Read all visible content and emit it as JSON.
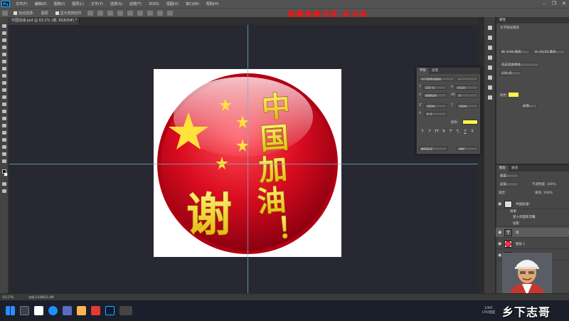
{
  "app": {
    "logo": "Ps",
    "tab_title": "中国加油.psd @ 63.2% (谢, RGB/8#) *"
  },
  "menu": [
    "文件(F)",
    "编辑(E)",
    "图像(I)",
    "图层(L)",
    "文字(Y)",
    "选择(S)",
    "滤镜(T)",
    "3D(D)",
    "视图(V)",
    "窗口(W)",
    "帮助(H)"
  ],
  "window_controls": {
    "minimize": "–",
    "restore": "❐",
    "close": "✕"
  },
  "options": {
    "auto_select": "自动选择:",
    "layer": "图层",
    "show_transform": "显示变换控件"
  },
  "overlay_title": "屏幕录像专家 未注册",
  "badge": {
    "title_chars": [
      "中",
      "国",
      "加",
      "油",
      "！"
    ],
    "thanks": "谢",
    "colors": {
      "red": "#d90b1f",
      "dark_red": "#8c0010",
      "yellow": "#ffe23a",
      "gold": "#c79a00"
    }
  },
  "status": {
    "zoom": "63.17%",
    "doc": "文档:2.63M/11.4M"
  },
  "properties": {
    "tab": "属性",
    "section": "文字图层属性",
    "w": "W: 3.94 厘米",
    "h": "H: 10.53 厘米",
    "font": "方正毛体简体",
    "size": "120 点",
    "color_label": "颜色:",
    "more": "段落..."
  },
  "character": {
    "tabs": [
      "字符",
      "段落"
    ],
    "font": "方正粗黑宋简体",
    "style": "-",
    "size": "120 点",
    "leading": "(自动)",
    "tracking": "0",
    "kerning": "度量标准",
    "scale_v": "100%",
    "scale_h": "100%",
    "baseline": "0 点",
    "color_label": "颜色:",
    "type_buttons": [
      "T",
      "T",
      "TT",
      "Tr",
      "T'",
      "T,",
      "T",
      "Ŧ"
    ],
    "lang": "美国英语",
    "aa": "锐利"
  },
  "layers": {
    "tabs": [
      "图层",
      "通道"
    ],
    "kind": "类型",
    "blend": "正常",
    "opacity": "不透明度: 100%",
    "lock": "锁定:",
    "fill": "填充: 100%",
    "items": [
      {
        "name": "中国加油！"
      },
      {
        "name": "效果"
      },
      {
        "name": "星十斜面和浮雕"
      },
      {
        "name": "投影"
      },
      {
        "name": "谢"
      },
      {
        "name": "图层 1"
      },
      {
        "name": "背景"
      }
    ]
  },
  "taskbar": {
    "time": "10PC",
    "cpu": "CPU温度"
  },
  "watermark": "乡下志哥"
}
